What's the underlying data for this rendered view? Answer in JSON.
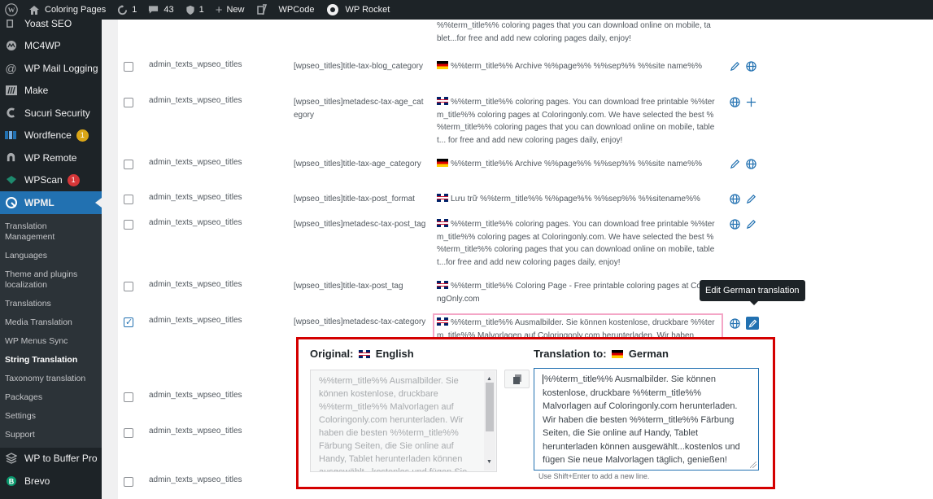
{
  "adminbar": {
    "site_name": "Coloring Pages",
    "updates_count": "1",
    "comments_count": "43",
    "security_count": "1",
    "new_label": "New",
    "wpcode_label": "WPCode",
    "wprocket_label": "WP Rocket"
  },
  "sidebar": {
    "items": [
      {
        "label": "Yoast SEO",
        "icon": "yoast-icon"
      },
      {
        "label": "MC4WP",
        "icon": "mc4wp-icon"
      },
      {
        "label": "WP Mail Logging",
        "icon": "at-icon"
      },
      {
        "label": "Make",
        "icon": "make-icon"
      },
      {
        "label": "Sucuri Security",
        "icon": "sucuri-icon"
      },
      {
        "label": "Wordfence",
        "icon": "wordfence-icon",
        "badge": "1",
        "badge_color": "#dba617"
      },
      {
        "label": "WP Remote",
        "icon": "remote-icon"
      },
      {
        "label": "WPScan",
        "icon": "wpscan-icon",
        "badge": "1",
        "badge_color": "#d63638"
      },
      {
        "label": "WPML",
        "icon": "wpml-icon"
      }
    ],
    "submenu": [
      "Translation Management",
      "Languages",
      "Theme and plugins localization",
      "Translations",
      "Media Translation",
      "WP Menus Sync",
      "String Translation",
      "Taxonomy translation",
      "Packages",
      "Settings",
      "Support"
    ],
    "after": [
      {
        "label": "WP to Buffer Pro",
        "icon": "buffer-icon"
      },
      {
        "label": "Brevo",
        "icon": "brevo-icon"
      }
    ]
  },
  "rows": {
    "r0": {
      "val": "%%term_title%% coloring pages that you can download online on mobile, tablet...for free and add new coloring pages daily, enjoy!"
    },
    "r1": {
      "ctx": "admin_texts_wpseo_titles",
      "name": "[wpseo_titles]title-tax-blog_category",
      "val": "%%term_title%% Archive %%page%% %%sep%% %%site name%%"
    },
    "r2": {
      "ctx": "admin_texts_wpseo_titles",
      "name": "[wpseo_titles]metadesc-tax-age_category",
      "val": "%%term_title%% coloring pages. You can download free printable %%term_title%% coloring pages at Coloringonly.com. We have selected the best %%term_title%% coloring pages that you can download online on mobile, tablet... for free and add new coloring pages daily, enjoy!"
    },
    "r3": {
      "ctx": "admin_texts_wpseo_titles",
      "name": "[wpseo_titles]title-tax-age_category",
      "val": "%%term_title%% Archive %%page%% %%sep%% %%site name%%"
    },
    "r4": {
      "ctx": "admin_texts_wpseo_titles",
      "name": "[wpseo_titles]title-tax-post_format",
      "val": "Lưu trữ %%term_title%% %%page%% %%sep%% %%sitename%%"
    },
    "r5": {
      "ctx": "admin_texts_wpseo_titles",
      "name": "[wpseo_titles]metadesc-tax-post_tag",
      "val": "%%term_title%% coloring pages. You can download free printable %%term_title%% coloring pages at Coloringonly.com. We have selected the best %%term_title%% coloring pages that you can download online on mobile, tablet...for free and add new coloring pages daily, enjoy!"
    },
    "r6": {
      "ctx": "admin_texts_wpseo_titles",
      "name": "[wpseo_titles]title-tax-post_tag",
      "val": "%%term_title%% Coloring Page - Free printable coloring pages at ColoringOnly.com"
    },
    "r7": {
      "ctx": "admin_texts_wpseo_titles",
      "name": "[wpseo_titles]metadesc-tax-category",
      "val": "%%term_title%% Ausmalbilder. Sie können kostenlose, druckbare %%term_title%% Malvorlagen auf Coloringonly.com herunterladen. Wir haben"
    },
    "r8": {
      "ctx": "admin_texts_wpseo_titles"
    },
    "r9": {
      "ctx": "admin_texts_wpseo_titles"
    },
    "r10": {
      "ctx": "admin_texts_wpseo_titles"
    }
  },
  "tooltip": "Edit German translation",
  "editor": {
    "original_label": "Original:",
    "original_lang": "English",
    "translation_label": "Translation to:",
    "translation_lang": "German",
    "original_text": "%%term_title%% Ausmalbilder. Sie können kostenlose, druckbare %%term_title%% Malvorlagen auf Coloringonly.com herunterladen. Wir haben die besten %%term_title%% Färbung Seiten, die Sie online auf Handy, Tablet herunterladen können ausgewählt...kostenlos und fügen Sie neue Malvorlagen täglich, genießen!",
    "translation_text": "%%term_title%% Ausmalbilder. Sie können kostenlose, druckbare %%term_title%% Malvorlagen auf Coloringonly.com herunterladen. Wir haben die besten %%term_title%% Färbung Seiten, die Sie online auf Handy, Tablet herunterladen können ausgewählt...kostenlos und fügen Sie neue Malvorlagen täglich, genießen!",
    "hint": "Use Shift+Enter to add a new line."
  },
  "colors": {
    "accent": "#2271b1",
    "highlight_border": "#d40000",
    "pink_border": "#f4a6c6"
  }
}
